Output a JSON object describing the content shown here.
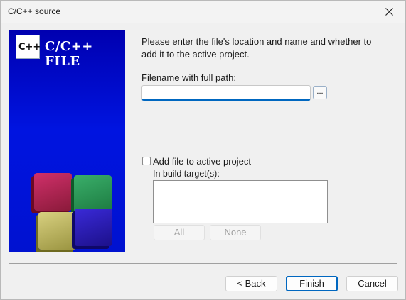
{
  "window": {
    "title": "C/C++ source"
  },
  "wizard": {
    "logo_text": "C++",
    "banner_title": "C/C++ FILE"
  },
  "intro": {
    "text": "Please enter the file's location and name and whether to add it to the active project."
  },
  "filename": {
    "label": "Filename with full path:",
    "value": "",
    "browse_label": "..."
  },
  "project": {
    "add_label": "Add file to active project",
    "add_checked": false,
    "targets_label": "In build target(s):",
    "all_label": "All",
    "none_label": "None"
  },
  "footer": {
    "back_label": "< Back",
    "finish_label": "Finish",
    "cancel_label": "Cancel"
  },
  "icons": {
    "close": "close-icon",
    "checkbox": "checkbox-icon"
  },
  "colors": {
    "accent": "#0067c0",
    "banner": "#0010d0"
  }
}
